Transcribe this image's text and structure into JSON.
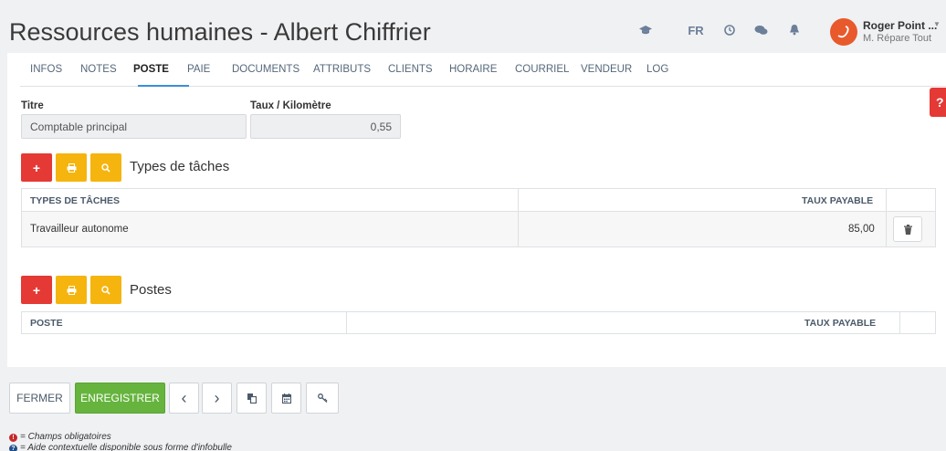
{
  "header": {
    "title": "Ressources humaines - Albert Chiffrier",
    "language": "FR",
    "icons": [
      "graduation-cap-icon",
      "clock-icon",
      "chat-icon",
      "bell-icon"
    ],
    "user": {
      "name": "Roger Point ...",
      "company": "M. Répare Tout"
    }
  },
  "tabs": [
    {
      "label": "INFOS"
    },
    {
      "label": "NOTES"
    },
    {
      "label": "POSTE",
      "active": true
    },
    {
      "label": "PAIE"
    },
    {
      "label": "DOCUMENTS"
    },
    {
      "label": "ATTRIBUTS"
    },
    {
      "label": "CLIENTS"
    },
    {
      "label": "HORAIRE"
    },
    {
      "label": "COURRIEL"
    },
    {
      "label": "VENDEUR"
    },
    {
      "label": "LOG"
    }
  ],
  "help": {
    "label": "?"
  },
  "form": {
    "titre_label": "Titre",
    "titre_value": "Comptable principal",
    "taux_km_label": "Taux / Kilomètre",
    "taux_km_value": "0,55"
  },
  "types_taches": {
    "title": "Types de tâches",
    "headers": [
      "TYPES DE TÂCHES",
      "TAUX PAYABLE"
    ],
    "rows": [
      {
        "type": "Travailleur autonome",
        "taux": "85,00"
      }
    ]
  },
  "postes": {
    "title": "Postes",
    "headers": [
      "POSTE",
      "TAUX PAYABLE"
    ]
  },
  "buttons": {
    "add": "+",
    "print": "🖶",
    "search": "Q"
  },
  "footer": {
    "fermer": "FERMER",
    "enregistrer": "ENREGISTRER",
    "prev": "‹",
    "next": "›"
  },
  "legend": {
    "required": "= Champs obligatoires",
    "help": "= Aide contextuelle disponible sous forme d'infobulle"
  },
  "colors": {
    "red": "#e53935",
    "yellow": "#f6b40e",
    "green": "#66b43e",
    "accent": "#3a8fd8"
  }
}
